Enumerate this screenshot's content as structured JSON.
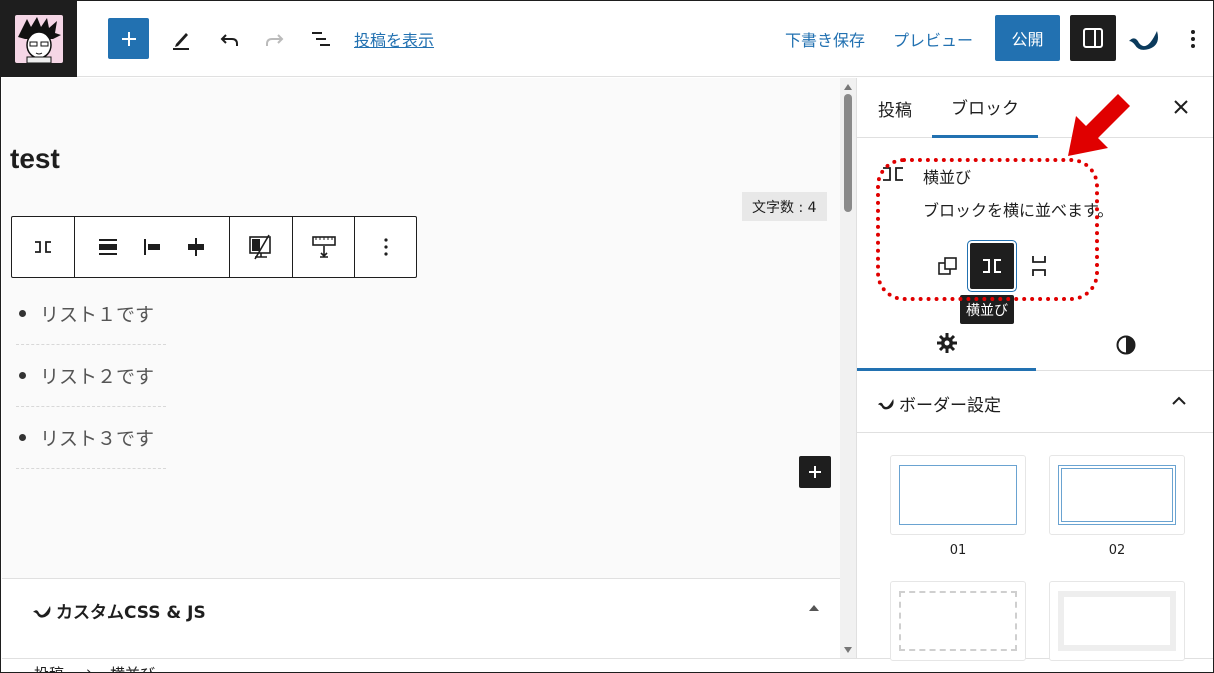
{
  "topbar": {
    "view_post_link": "投稿を表示",
    "save_draft": "下書き保存",
    "preview": "プレビュー",
    "publish": "公開"
  },
  "editor": {
    "post_title": "test",
    "word_count": "文字数 : 4",
    "list_items": [
      "リスト１です",
      "リスト２です",
      "リスト３です"
    ],
    "custom_css_js_title": "カスタムCSS & JS"
  },
  "breadcrumb": {
    "items": [
      "投稿",
      "横並び"
    ]
  },
  "sidebar": {
    "tabs": {
      "post": "投稿",
      "block": "ブロック"
    },
    "block_name": "横並び",
    "block_description": "ブロックを横に並べます。",
    "tooltip": "横並び",
    "border_settings_title": "ボーダー設定",
    "border_presets": [
      {
        "label": "01"
      },
      {
        "label": "02"
      },
      {
        "label": ""
      },
      {
        "label": ""
      }
    ]
  },
  "colors": {
    "accent": "#2271b1",
    "dark": "#1e1e1e",
    "annotation": "#e00000"
  },
  "icons": {
    "block": "row-icon",
    "variations": [
      "group-icon",
      "row-icon",
      "stack-icon"
    ]
  }
}
